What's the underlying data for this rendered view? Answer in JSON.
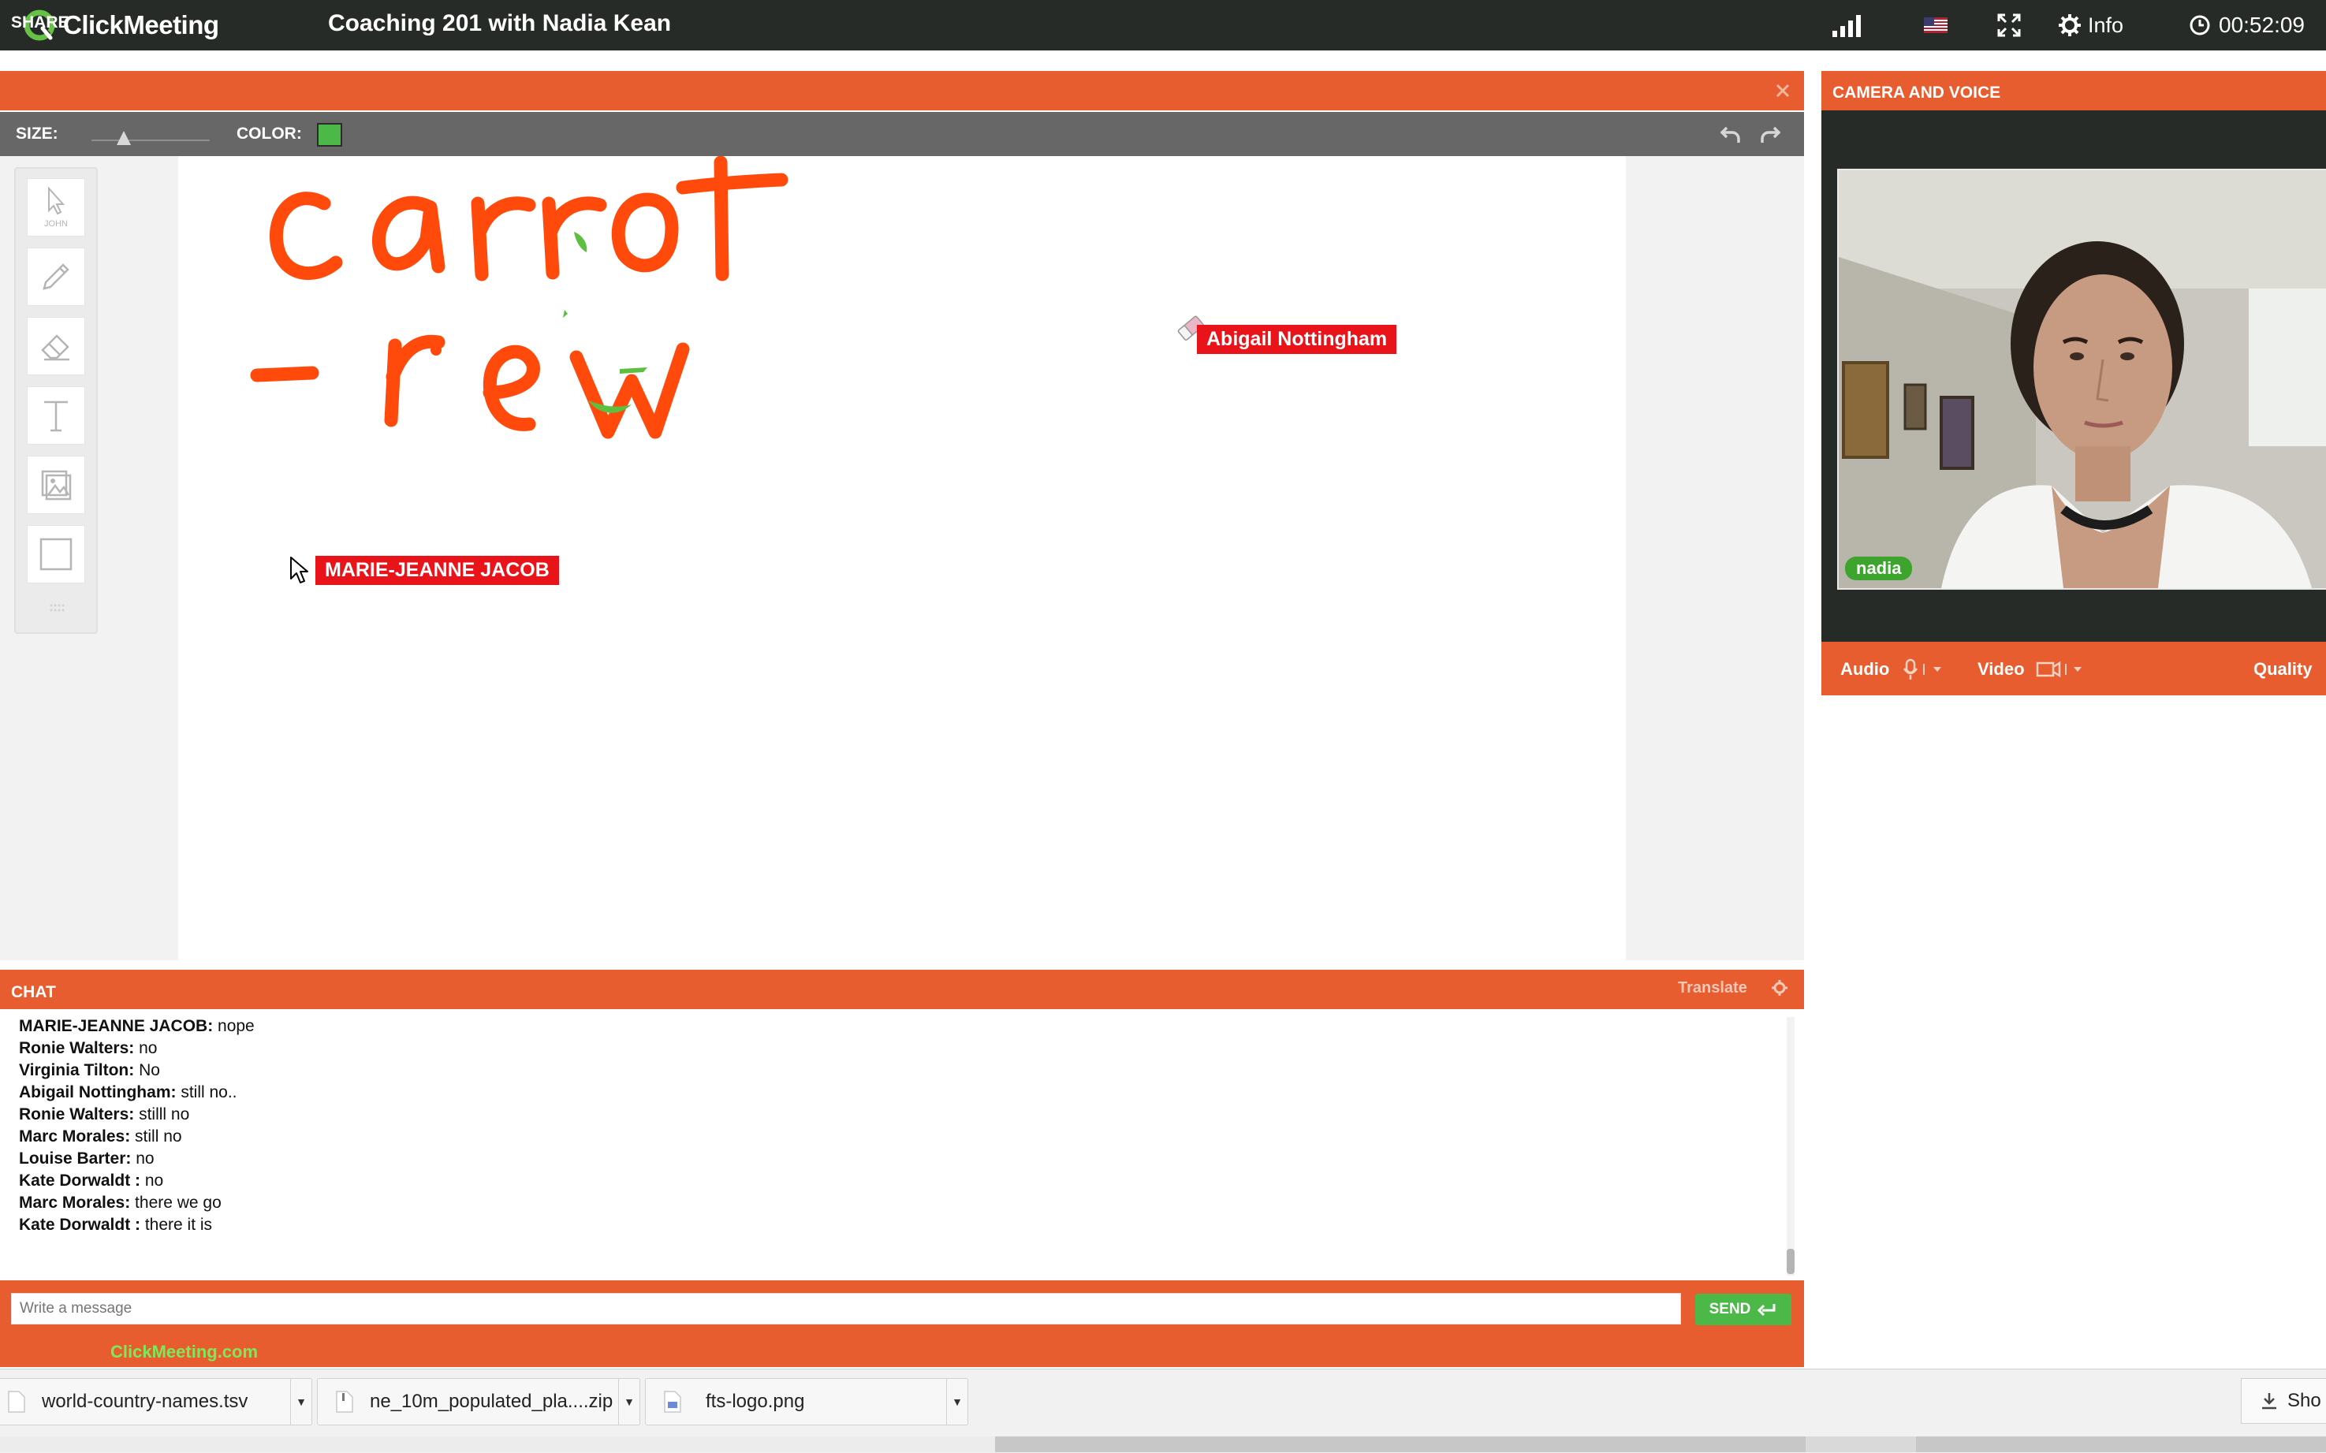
{
  "app": {
    "brand": "ClickMeeting",
    "session_title": "Coaching 201 with Nadia Kean",
    "info_label": "Info",
    "timer": "00:52:09"
  },
  "share": {
    "title": "SHARE",
    "size_label": "SIZE:",
    "color_label": "COLOR:",
    "selected_color": "#4cb848",
    "size_value_fraction": 0.27,
    "pointer_tool_label": "JOHN",
    "whiteboard_text_line1": "carrot",
    "whiteboard_text_line2": "-rew",
    "user_cursors": [
      {
        "name": "Abigail Nottingham"
      },
      {
        "name": "MARIE-JEANNE JACOB"
      }
    ]
  },
  "camera": {
    "title": "CAMERA AND VOICE",
    "participant": "nadia",
    "audio_label": "Audio",
    "video_label": "Video",
    "quality_label": "Quality"
  },
  "chat": {
    "title": "CHAT",
    "translate_label": "Translate",
    "messages": [
      {
        "author": "MARIE-JEANNE JACOB:",
        "text": " nope"
      },
      {
        "author": "Ronie Walters:",
        "text": " no"
      },
      {
        "author": "Virginia Tilton:",
        "text": " No"
      },
      {
        "author": "Abigail Nottingham:",
        "text": " still no.."
      },
      {
        "author": "Ronie Walters:",
        "text": " stilll no"
      },
      {
        "author": "Marc Morales:",
        "text": " still no"
      },
      {
        "author": "Louise Barter:",
        "text": " no"
      },
      {
        "author": "Kate Dorwaldt :",
        "text": " no"
      },
      {
        "author": "Marc Morales:",
        "text": " there we go"
      },
      {
        "author": "Kate Dorwaldt :",
        "text": " there it is"
      }
    ],
    "input_placeholder": "Write a message",
    "send_label": "SEND",
    "footer_link": "ClickMeeting.com"
  },
  "downloads": {
    "items": [
      {
        "name": "world-country-names.tsv",
        "icon": "file-icon"
      },
      {
        "name": "ne_10m_populated_pla....zip",
        "icon": "zip-file-icon"
      },
      {
        "name": "fts-logo.png",
        "icon": "image-file-icon"
      }
    ],
    "show_all_label": "Sho"
  },
  "colors": {
    "accent_orange": "#e85d2f",
    "topbar": "#262b28",
    "send_green": "#4cb848",
    "cursor_tag_red": "#e8141a",
    "ink_orange": "#ff4a0b"
  }
}
